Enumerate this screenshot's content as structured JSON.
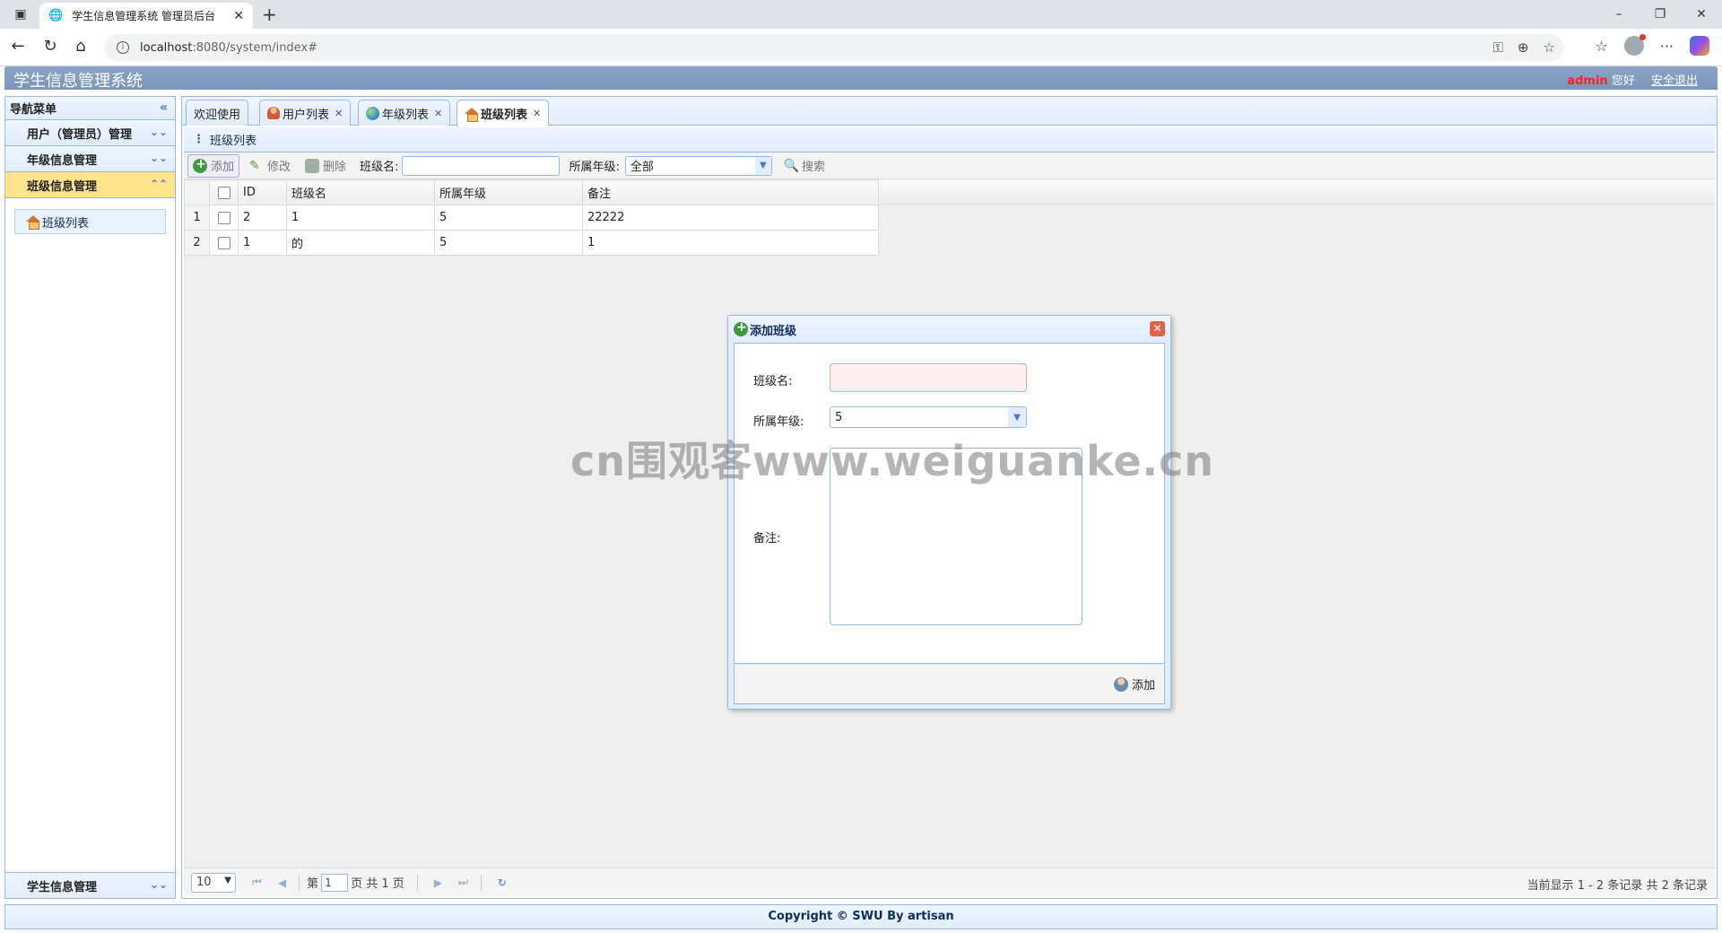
{
  "browser": {
    "tab_title": "学生信息管理系统 管理员后台",
    "url_host": "localhost",
    "url_rest": ":8080/system/index#"
  },
  "app": {
    "title": "学生信息管理系统",
    "user": "admin",
    "greeting": "您好",
    "logout": "安全退出"
  },
  "sidebar": {
    "header": "导航菜单",
    "sections": [
      {
        "label": "用户（管理员）管理"
      },
      {
        "label": "年级信息管理"
      },
      {
        "label": "班级信息管理"
      }
    ],
    "link": "班级列表",
    "bottom_section": "学生信息管理"
  },
  "tabs": [
    {
      "label": "欢迎使用"
    },
    {
      "label": "用户列表"
    },
    {
      "label": "年级列表"
    },
    {
      "label": "班级列表"
    }
  ],
  "panel_title": "班级列表",
  "toolbar": {
    "add": "添加",
    "edit": "修改",
    "delete": "删除",
    "class_name_label": "班级名:",
    "grade_label": "所属年级:",
    "grade_value": "全部",
    "search": "搜索"
  },
  "grid": {
    "columns": [
      "ID",
      "班级名",
      "所属年级",
      "备注"
    ],
    "rows": [
      {
        "rn": "1",
        "id": "2",
        "name": "1",
        "grade": "5",
        "note": "22222"
      },
      {
        "rn": "2",
        "id": "1",
        "name": "的",
        "grade": "5",
        "note": "1"
      }
    ]
  },
  "pager": {
    "page_size": "10",
    "page_prefix": "第",
    "page_value": "1",
    "page_suffix": "页 共 1 页",
    "info": "当前显示 1 - 2 条记录 共 2 条记录"
  },
  "dialog": {
    "title": "添加班级",
    "class_name_label": "班级名:",
    "grade_label": "所属年级:",
    "grade_value": "5",
    "note_label": "备注:",
    "add_button": "添加"
  },
  "footer": "Copyright © SWU By artisan",
  "watermark": "cn围观客www.weiguanke.cn",
  "colors": {
    "header": "#7b96bb",
    "border": "#95b8e7",
    "active_section": "#ffe48d",
    "admin": "#ff2020"
  }
}
